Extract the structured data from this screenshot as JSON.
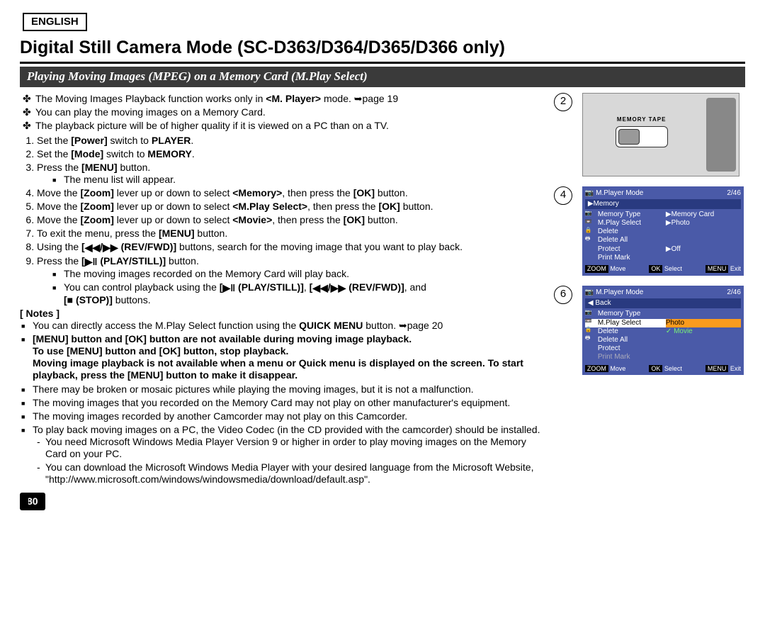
{
  "lang": "ENGLISH",
  "title": "Digital Still Camera Mode (SC-D363/D364/D365/D366 only)",
  "subheader": "Playing Moving Images (MPEG) on a Memory Card (M.Play Select)",
  "intro": {
    "i1a": "The Moving Images Playback function works only in ",
    "i1b": "<M. Player>",
    "i1c": " mode. ➥page 19",
    "i2": "You can play the moving images on a Memory Card.",
    "i3": "The playback picture will be of higher quality if it is viewed on a PC  than on a TV."
  },
  "steps": {
    "s1a": "Set the ",
    "s1b": "[Power]",
    "s1c": " switch to ",
    "s1d": "PLAYER",
    "s1e": ".",
    "s2a": "Set the ",
    "s2b": "[Mode]",
    "s2c": " switch to ",
    "s2d": "MEMORY",
    "s2e": ".",
    "s3a": "Press the ",
    "s3b": "[MENU]",
    "s3c": " button.",
    "s3sub": "The menu list will appear.",
    "s4a": "Move the ",
    "s4b": "[Zoom]",
    "s4c": " lever up or down to select ",
    "s4d": "<Memory>",
    "s4e": ", then press the ",
    "s4f": "[OK]",
    "s4g": " button.",
    "s5a": "Move the ",
    "s5b": "[Zoom]",
    "s5c": " lever up or down to select ",
    "s5d": "<M.Play Select>",
    "s5e": ", then press the ",
    "s5f": "[OK]",
    "s5g": " button.",
    "s6a": "Move the ",
    "s6b": "[Zoom]",
    "s6c": " lever up or down to select ",
    "s6d": "<Movie>",
    "s6e": ", then press the ",
    "s6f": "[OK]",
    "s6g": " button.",
    "s7a": "To exit the menu, press the ",
    "s7b": "[MENU]",
    "s7c": " button.",
    "s8a": "Using the ",
    "s8b": "(REV/FWD)]",
    "s8c": " buttons, search for the moving image that you want to play back.",
    "s9a": "Press the ",
    "s9b": "(PLAY/STILL)]",
    "s9c": " button.",
    "s9sub1": "The moving images recorded on the Memory Card will play back.",
    "s9sub2a": "You can control playback using the ",
    "s9sub2b": "(PLAY/STILL)]",
    "s9sub2c": ", ",
    "s9sub2d": "(REV/FWD)]",
    "s9sub2e": ", and",
    "s9sub3a": "[",
    "s9sub3b": "■",
    "s9sub3c": " (STOP)]",
    "s9sub3d": " buttons."
  },
  "noteslabel": "[ Notes ]",
  "notes": {
    "n1a": "You can directly access the M.Play Select function using the ",
    "n1b": "QUICK MENU",
    "n1c": " button. ➥page 20",
    "n2a": "[MENU] button and [OK] button are not available during moving image playback.",
    "n2b": "To use [MENU] button and [OK] button, stop playback.",
    "n2c": "Moving image playback is not available when a menu or Quick menu is displayed on the screen. To start playback, press the [MENU] button to make it disappear.",
    "n3": "There may be broken or mosaic pictures while playing the moving images, but it is not a malfunction.",
    "n4": "The moving images that you recorded on the Memory Card may not play on other manufacturer's equipment.",
    "n5": "The moving images recorded by another Camcorder may not play on this Camcorder.",
    "n6": "To play back moving images on a PC, the Video Codec (in the CD provided with the camcorder) should be installed.",
    "n6d1": "You need Microsoft Windows Media Player Version 9 or higher in order to play moving images on the Memory Card on your PC.",
    "n6d2": "You can download the Microsoft Windows Media Player with your desired language from the Microsoft Website, \"http://www.microsoft.com/windows/windowsmedia/download/default.asp\"."
  },
  "pagenum": "80",
  "diagram": {
    "num2": "2",
    "num4": "4",
    "num6": "6",
    "switchLabel": "MEMORY  TAPE",
    "scr4": {
      "mode": "M.Player Mode",
      "count": "2/46",
      "top": "▶Memory",
      "r1a": "Memory Type",
      "r1b": "▶Memory Card",
      "r2a": "M.Play Select",
      "r2b": "▶Photo",
      "r3": "Delete",
      "r4": "Delete All",
      "r5a": "Protect",
      "r5b": "▶Off",
      "r6": "Print Mark"
    },
    "scr6": {
      "mode": "M.Player Mode",
      "count": "2/46",
      "top": "◀ Back",
      "r1": "Memory Type",
      "r2a": "M.Play Select",
      "r2b": "Photo",
      "r3a": "Delete",
      "r3b": "Movie",
      "r4": "Delete All",
      "r5": "Protect",
      "r6": "Print Mark"
    },
    "footer": {
      "zoom": "ZOOM",
      "move": " Move",
      "ok": "OK",
      "select": " Select",
      "menu": "MENU",
      "exit": " Exit"
    }
  }
}
